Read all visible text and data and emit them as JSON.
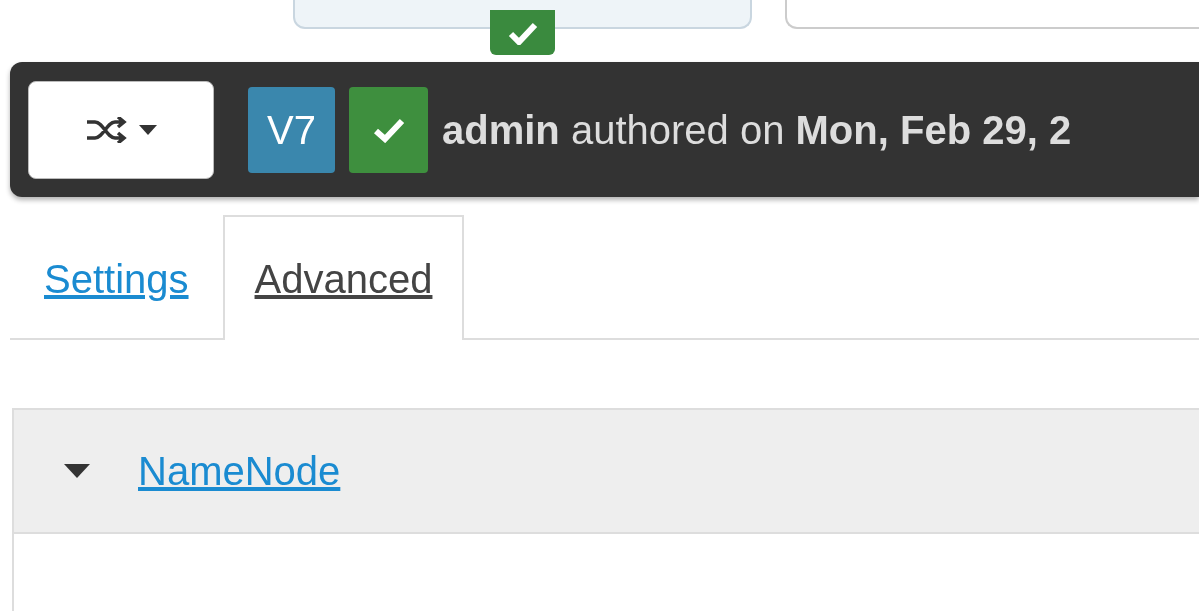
{
  "version_bar": {
    "version": "V7",
    "current": true,
    "summary": "**admin** authored on **Mon, Feb 29, 2**"
  },
  "tabs": [
    {
      "label": "Settings",
      "selected": false
    },
    {
      "label": "Advanced",
      "selected": true
    }
  ],
  "sections": [
    {
      "title": "NameNode",
      "expanded": true
    }
  ]
}
